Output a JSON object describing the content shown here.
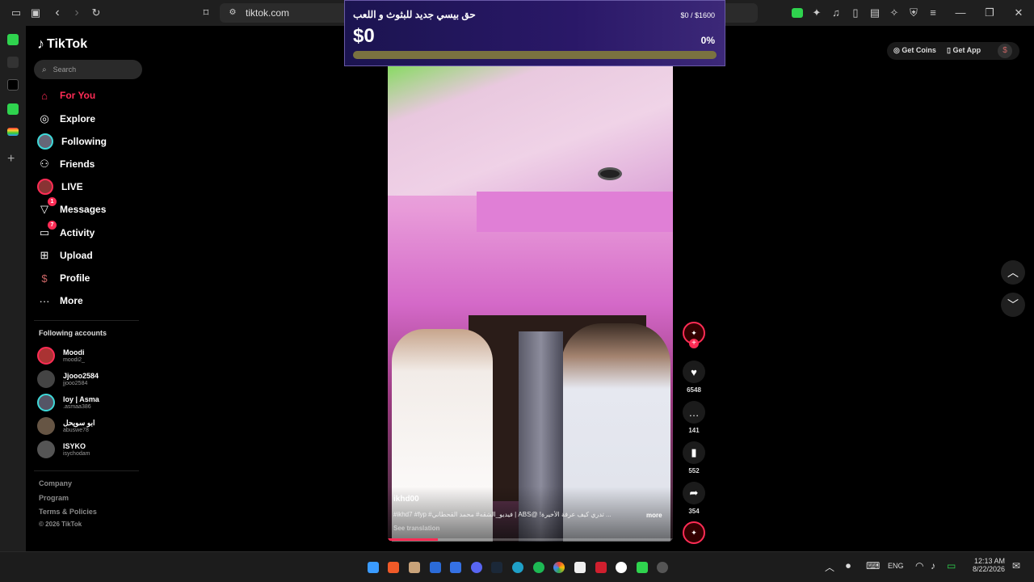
{
  "browser": {
    "url": "tiktok.com",
    "icons": [
      "sidebar-toggle-icon",
      "tab-icon",
      "back-icon",
      "forward-icon",
      "reload-icon",
      "bookmark-icon",
      "site-info-icon"
    ],
    "extension_icons": [
      "extension-icon",
      "music-icon",
      "sidebar-icon",
      "wallet-icon",
      "ai-icon",
      "shield-icon",
      "menu-icon"
    ],
    "window_controls": {
      "minimize": "—",
      "restore": "❐",
      "close": "✕"
    }
  },
  "app": {
    "name": "TikTok",
    "search_placeholder": "Search",
    "nav": [
      {
        "label": "For You",
        "icon": "home-icon",
        "active": true
      },
      {
        "label": "Explore",
        "icon": "compass-icon"
      },
      {
        "label": "Following",
        "icon": "following-avatar"
      },
      {
        "label": "Friends",
        "icon": "friends-icon"
      },
      {
        "label": "LIVE",
        "icon": "live-avatar"
      },
      {
        "label": "Messages",
        "icon": "messages-icon",
        "badge": "1"
      },
      {
        "label": "Activity",
        "icon": "activity-icon",
        "badge": "7"
      },
      {
        "label": "Upload",
        "icon": "upload-icon"
      },
      {
        "label": "Profile",
        "icon": "profile-icon"
      },
      {
        "label": "More",
        "icon": "more-icon"
      }
    ],
    "following_heading": "Following accounts",
    "accounts": [
      {
        "name": "Moodi",
        "handle": "moodi2_"
      },
      {
        "name": "Jjooo2584",
        "handle": "jjooo2584"
      },
      {
        "name": "loy | Asma",
        "handle": ".asmaa386"
      },
      {
        "name": "ابو سويحل",
        "handle": "abuswe78"
      },
      {
        "name": "ISYKO",
        "handle": "isychodam"
      }
    ],
    "footer": [
      "Company",
      "Program",
      "Terms & Policies",
      "© 2026 TikTok"
    ]
  },
  "header_actions": {
    "get_coins": "Get Coins",
    "get_app": "Get App"
  },
  "donation": {
    "title": "حق بيسي جديد للبثوث و اللعب",
    "amount": "$0",
    "goal": "$0 / $1600",
    "percent": "0%",
    "progress": 0
  },
  "video": {
    "username": "ikhd00",
    "caption": "#ikhd7 #fyp #فيديو_الشقه# محمد القحطاني | ABS@ !تدري كيف عرفة الأخيرة ...",
    "more": "more",
    "see_translation": "See translation",
    "likes": "6548",
    "comments": "141",
    "saves": "552",
    "shares": "354"
  },
  "taskbar": {
    "language": "ENG",
    "time": "12:13 AM",
    "date": "8/22/2026"
  }
}
